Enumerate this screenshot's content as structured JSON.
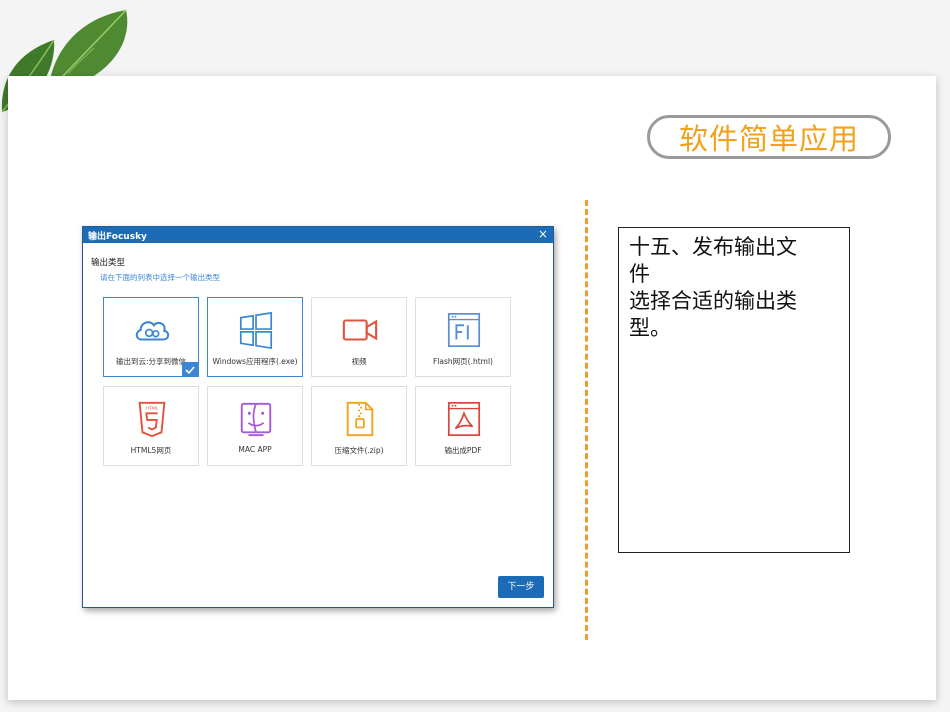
{
  "slide": {
    "title": "软件简单应用",
    "body_lines": [
      "十五、发布输出文",
      "件",
      "选择合适的输出类",
      "型。"
    ]
  },
  "app": {
    "window_title": "输出Focusky",
    "close_glyph": "×",
    "section_title": "输出类型",
    "section_subtitle": "请在下面的列表中选择一个输出类型",
    "options": [
      {
        "label": "输出到云:分享到微信",
        "icon": "cloud-icon",
        "selected": true
      },
      {
        "label": "Windows应用程序(.exe)",
        "icon": "windows-icon",
        "selected": false
      },
      {
        "label": "视频",
        "icon": "video-camera-icon",
        "selected": false
      },
      {
        "label": "Flash网页(.html)",
        "icon": "flash-icon",
        "selected": false
      },
      {
        "label": "HTML5网页",
        "icon": "html5-icon",
        "selected": false
      },
      {
        "label": "MAC APP",
        "icon": "mac-finder-icon",
        "selected": false
      },
      {
        "label": "压缩文件(.zip)",
        "icon": "zip-file-icon",
        "selected": false
      },
      {
        "label": "输出成PDF",
        "icon": "pdf-icon",
        "selected": false
      }
    ],
    "next_label": "下一步"
  },
  "colors": {
    "accent_orange": "#f2a21a",
    "window_blue": "#1c6bb6",
    "selection_blue": "#3d86d4"
  }
}
